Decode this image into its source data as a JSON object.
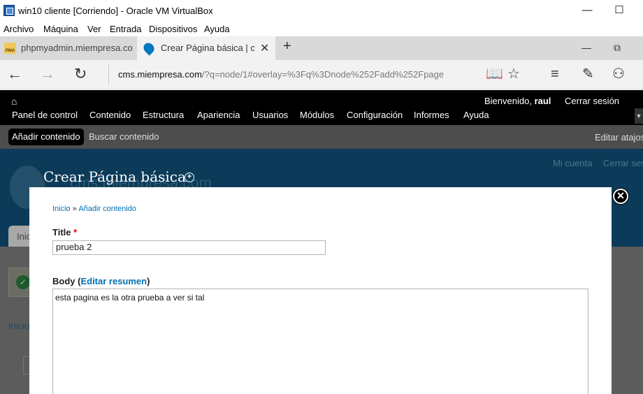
{
  "vm_window": {
    "title": "win10 cliente [Corriendo] - Oracle VM VirtualBox",
    "menu": [
      "Archivo",
      "Máquina",
      "Ver",
      "Entrada",
      "Dispositivos",
      "Ayuda"
    ],
    "minimize": "—",
    "maximize": "☐"
  },
  "browser": {
    "tabs": [
      {
        "label": "phpmyadmin.miempresa.com",
        "icon_text": "PMA"
      },
      {
        "label": "Crear Página básica | cms",
        "close": "✕"
      }
    ],
    "new_tab": "+",
    "tab_minimize": "—",
    "tab_restore": "⧉",
    "back": "←",
    "forward": "→",
    "refresh": "↻",
    "url_domain": "cms.miempresa.com",
    "url_path": "/?q=node/1#overlay=%3Fq%3Dnode%252Fadd%252Fpage",
    "reading_view": "📖",
    "favorite": "☆",
    "hub": "≡",
    "notes": "✎",
    "share": "⚇"
  },
  "drupal_toolbar": {
    "home": "⌂",
    "menu": [
      "Panel de control",
      "Contenido",
      "Estructura",
      "Apariencia",
      "Usuarios",
      "Módulos",
      "Configuración",
      "Informes",
      "Ayuda"
    ],
    "welcome": "Bienvenido,",
    "username": "raul",
    "logout": "Cerrar sesión",
    "toggle": "▼",
    "shortcuts": [
      "Añadir contenido",
      "Buscar contenido"
    ],
    "edit_shortcuts": "Editar atajos"
  },
  "background_page": {
    "site_name": "cms.miempresa.com",
    "my_account": "Mi cuenta",
    "logout": "Cerrar sesión",
    "tab": "Inic",
    "home_crumb": "Inicio",
    "check": "✓"
  },
  "overlay": {
    "title": "Crear Página básica",
    "plus": "+",
    "close": "✕",
    "breadcrumb": {
      "home": "Inicio",
      "separator": " » ",
      "add": "Añadir contenido"
    },
    "title_label": "Title",
    "required_mark": "*",
    "title_value": "prueba 2",
    "body_label": "Body",
    "body_open": " (",
    "body_link": "Editar resumen",
    "body_close": ")",
    "body_value": "esta pagina es la otra prueba a ver si tal"
  }
}
